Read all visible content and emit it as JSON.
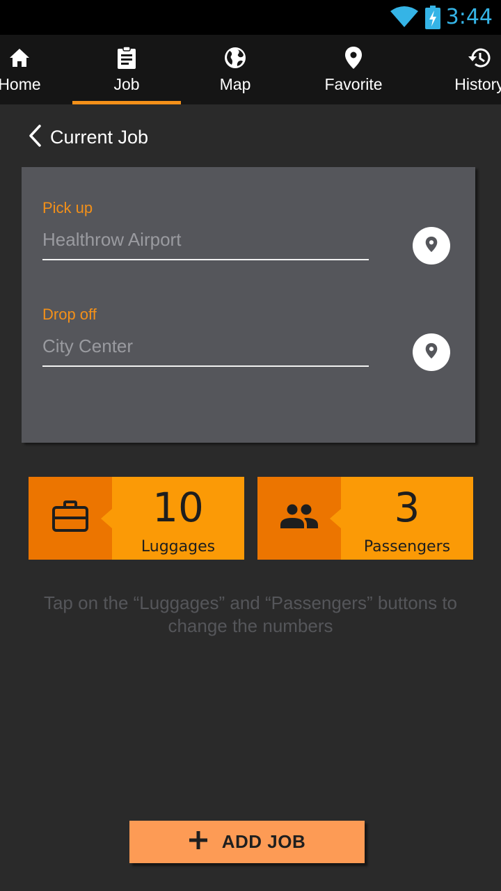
{
  "status_bar": {
    "time": "3:44",
    "icons": [
      "wifi-icon",
      "battery-charging-icon"
    ],
    "time_color": "#35b4e6"
  },
  "tabs": [
    {
      "label": "Home",
      "icon": "home-icon"
    },
    {
      "label": "Job",
      "icon": "clipboard-icon",
      "active": true
    },
    {
      "label": "Map",
      "icon": "globe-icon"
    },
    {
      "label": "Favorite",
      "icon": "location-pin-icon"
    },
    {
      "label": "History",
      "icon": "history-icon"
    }
  ],
  "header": {
    "title": "Current Job",
    "back_icon": "chevron-left-icon"
  },
  "form": {
    "pickup": {
      "label": "Pick up",
      "placeholder": "Healthrow Airport",
      "icon": "location-pin-icon"
    },
    "dropoff": {
      "label": "Drop off",
      "placeholder": "City Center",
      "icon": "location-pin-icon"
    }
  },
  "counters": {
    "luggages": {
      "value": "10",
      "label": "Luggages",
      "icon": "briefcase-icon"
    },
    "passengers": {
      "value": "3",
      "label": "Passengers",
      "icon": "people-icon"
    }
  },
  "hint": "Tap on the “Luggages” and “Passengers” buttons to change the numbers",
  "add_button": {
    "label": "ADD JOB",
    "icon": "plus-icon"
  },
  "colors": {
    "accent": "#f39019",
    "counter_bg": "#fb9a06",
    "counter_icon_bg": "#ec7500",
    "button_bg": "#fd9b55"
  }
}
